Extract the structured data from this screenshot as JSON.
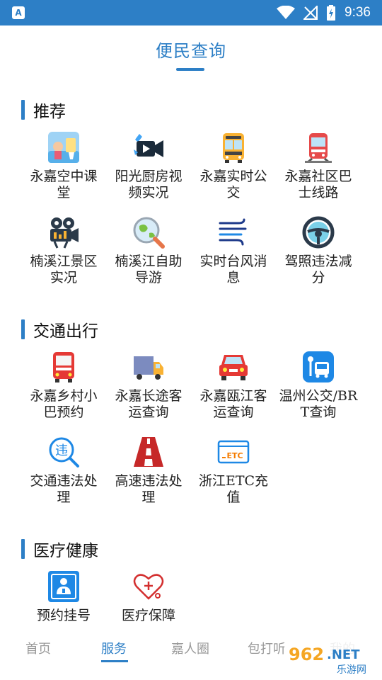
{
  "status_bar": {
    "badge": "A",
    "time": "9:36"
  },
  "header": {
    "title": "便民查询"
  },
  "sections": [
    {
      "title": "推荐",
      "items": [
        {
          "label": "永嘉空中课堂",
          "icon": "sky-classroom-icon"
        },
        {
          "label": "阳光厨房视频实况",
          "icon": "video-camera-icon"
        },
        {
          "label": "永嘉实时公交",
          "icon": "bus-front-icon"
        },
        {
          "label": "永嘉社区巴士线路",
          "icon": "community-bus-icon"
        },
        {
          "label": "楠溪江景区实况",
          "icon": "movie-camera-icon"
        },
        {
          "label": "楠溪江自助导游",
          "icon": "globe-magnifier-icon"
        },
        {
          "label": "实时台风消息",
          "icon": "wind-icon"
        },
        {
          "label": "驾照违法减分",
          "icon": "steering-wheel-icon"
        }
      ]
    },
    {
      "title": "交通出行",
      "items": [
        {
          "label": "永嘉乡村小巴预约",
          "icon": "red-bus-icon"
        },
        {
          "label": "永嘉长途客运查询",
          "icon": "truck-icon"
        },
        {
          "label": "永嘉瓯江客运查询",
          "icon": "red-car-icon"
        },
        {
          "label": "温州公交/BRT查询",
          "icon": "bus-stop-icon"
        },
        {
          "label": "交通违法处理",
          "icon": "traffic-violation-icon"
        },
        {
          "label": "高速违法处理",
          "icon": "highway-icon"
        },
        {
          "label": "浙江ETC充值",
          "icon": "etc-card-icon"
        }
      ]
    },
    {
      "title": "医疗健康",
      "items": [
        {
          "label": "预约挂号",
          "icon": "doctor-icon"
        },
        {
          "label": "医疗保障",
          "icon": "heart-stethoscope-icon"
        }
      ]
    }
  ],
  "bottom_nav": [
    {
      "label": "首页",
      "active": false
    },
    {
      "label": "服务",
      "active": true
    },
    {
      "label": "嘉人圈",
      "active": false
    },
    {
      "label": "包打听",
      "active": false
    },
    {
      "label": "我的",
      "active": false
    }
  ],
  "watermark": {
    "number": "962",
    "suffix": ".NET",
    "site": "乐游网"
  }
}
